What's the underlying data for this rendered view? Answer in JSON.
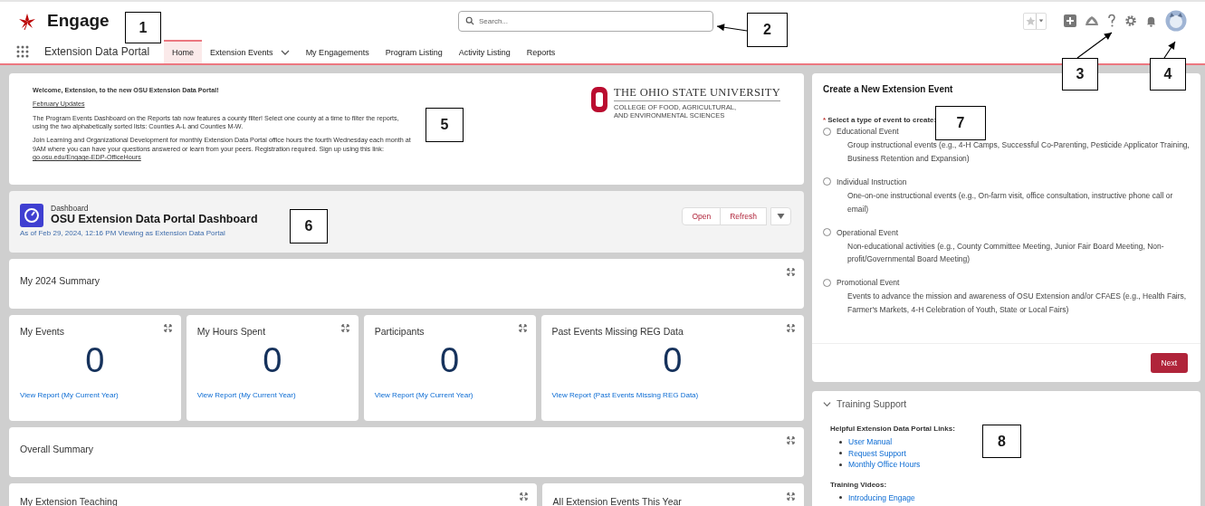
{
  "header": {
    "brand": "Engage",
    "search": {
      "placeholder": "Search..."
    }
  },
  "nav": {
    "app_name": "Extension Data Portal",
    "tabs": [
      {
        "label": "Home",
        "selected": true,
        "has_menu": false
      },
      {
        "label": "Extension Events",
        "selected": false,
        "has_menu": true
      },
      {
        "label": "My Engagements",
        "selected": false,
        "has_menu": false
      },
      {
        "label": "Program Listing",
        "selected": false,
        "has_menu": false
      },
      {
        "label": "Activity Listing",
        "selected": false,
        "has_menu": false
      },
      {
        "label": "Reports",
        "selected": false,
        "has_menu": false
      }
    ]
  },
  "welcome": {
    "heading": "Welcome, Extension, to the new OSU Extension Data Portal!",
    "updates_link": "February Updates",
    "paragraph_1": "The Program Events Dashboard on the Reports tab now features a county filter! Select one county at a time to filter the reports, using the two alphabetically sorted lists: Counties A-L and Counties M-W.",
    "paragraph_2": "Join Learning and Organizational Development for monthly Extension Data Portal office hours the fourth Wednesday each month at 9AM where you can have your questions answered or learn from your peers. Registration required. Sign up using this link:",
    "paragraph_2_link": "go.osu.edu/Engage-EDP-OfficeHours",
    "logo_title": "THE OHIO STATE UNIVERSITY",
    "logo_subtitle_1": "COLLEGE OF FOOD, AGRICULTURAL,",
    "logo_subtitle_2": "AND ENVIRONMENTAL SCIENCES"
  },
  "dashboard": {
    "kind_label": "Dashboard",
    "title": "OSU Extension Data Portal Dashboard",
    "subtitle": "As of Feb 29, 2024, 12:16 PM Viewing as Extension Data Portal",
    "buttons": [
      "Open",
      "Refresh"
    ]
  },
  "summary_1": {
    "title": "My 2024 Summary"
  },
  "metrics": [
    {
      "title": "My Events",
      "value": "0",
      "link": "View Report (My Current Year)"
    },
    {
      "title": "My Hours Spent",
      "value": "0",
      "link": "View Report (My Current Year)"
    },
    {
      "title": "Participants",
      "value": "0",
      "link": "View Report (My Current Year)"
    },
    {
      "title": "Past Events Missing REG Data",
      "value": "0",
      "link": "View Report (Past Events Missing REG Data)"
    }
  ],
  "summary_2": {
    "title": "Overall Summary"
  },
  "bottom_cards": [
    {
      "title": "My Extension Teaching"
    },
    {
      "title": "All Extension Events This Year"
    }
  ],
  "create_event": {
    "title": "Create a New Extension Event",
    "required_mark": "*",
    "prompt": "Select a type of event to create:",
    "options": [
      {
        "label": "Educational Event",
        "description": "Group instructional events (e.g., 4-H Camps, Successful Co-Parenting, Pesticide Applicator Training, Business Retention and Expansion)",
        "selected": false
      },
      {
        "label": "Individual Instruction",
        "description": "One-on-one instructional events (e.g., On-farm visit, office consultation, instructive phone call or email)",
        "selected": false
      },
      {
        "label": "Operational Event",
        "description": "Non-educational activities (e.g., County Committee Meeting, Junior Fair Board Meeting, Non-profit/Governmental Board Meeting)",
        "selected": false
      },
      {
        "label": "Promotional Event",
        "description": "Events to advance the mission and awareness of OSU Extension and/or CFAES (e.g., Health Fairs, Farmer's Markets, 4-H Celebration of Youth, State or Local Fairs)",
        "selected": false
      }
    ],
    "next_button": "Next"
  },
  "training": {
    "title": "Training Support",
    "expanded": true,
    "sections": [
      {
        "heading": "Helpful Extension Data Portal Links:",
        "links": [
          "User Manual",
          "Request Support",
          "Monthly Office Hours"
        ]
      },
      {
        "heading": "Training Videos:",
        "links": [
          "Introducing Engage"
        ]
      }
    ]
  },
  "callouts": [
    {
      "number": "1",
      "arrow": false
    },
    {
      "number": "2",
      "arrow": true
    },
    {
      "number": "3",
      "arrow": true
    },
    {
      "number": "4",
      "arrow": true
    },
    {
      "number": "5",
      "arrow": false
    },
    {
      "number": "6",
      "arrow": false
    },
    {
      "number": "7",
      "arrow": false
    },
    {
      "number": "8",
      "arrow": false
    }
  ]
}
